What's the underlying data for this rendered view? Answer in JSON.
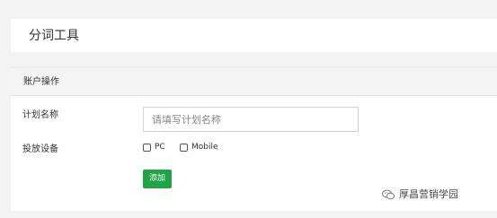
{
  "header": {
    "title": "分词工具"
  },
  "panel": {
    "title": "账户操作"
  },
  "form": {
    "plan_name_label": "计划名称",
    "plan_name_placeholder": "请填写计划名称",
    "plan_name_value": "",
    "device_label": "投放设备",
    "device_options": [
      {
        "label": "PC",
        "checked": false
      },
      {
        "label": "Mobile",
        "checked": false
      }
    ],
    "add_button_label": "添加"
  },
  "watermark": {
    "text": "厚昌营销学园",
    "icon": "wechat-icon"
  },
  "colors": {
    "page_background": "#f3f3f4",
    "panel_header_background": "#f5f5f5",
    "button_green": "#20a546"
  }
}
